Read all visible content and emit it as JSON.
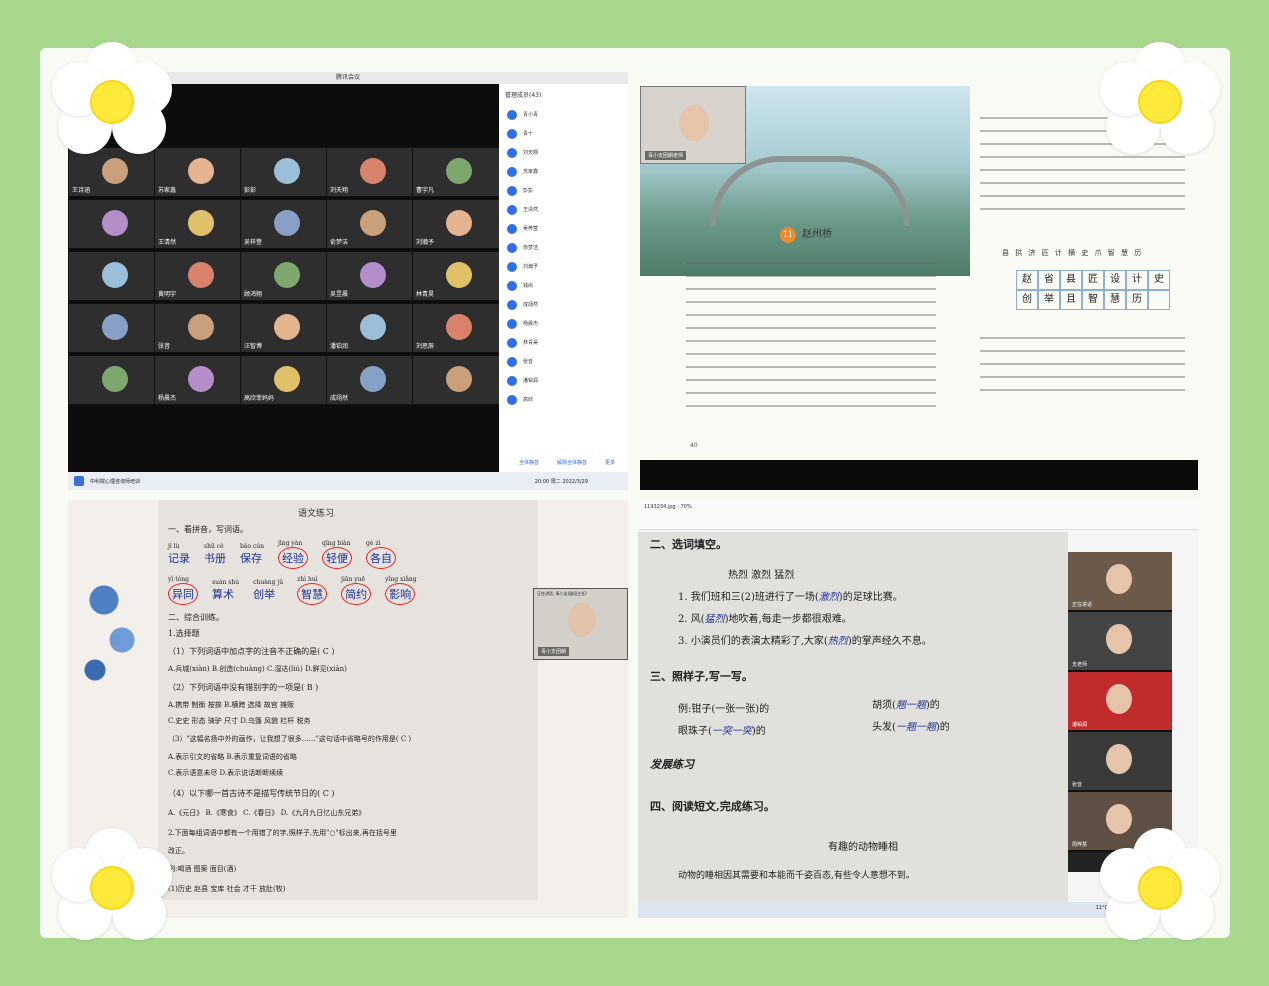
{
  "colors": {
    "background": "#a8d88e",
    "flower_center": "#ffe93a",
    "accent_blue": "#2f6ee8",
    "circle_red": "#e22222",
    "handwriting": "#1b2f9a"
  },
  "meeting": {
    "window_title": "腾讯会议",
    "sidebar_title": "管理成员(43)",
    "sidebar_names": [
      "青小青",
      "青十",
      "刘天翔",
      "苏家鑫",
      "彭彭",
      "王清然",
      "吴梓萱",
      "俞梦洁",
      "刘瀚予",
      "钱尚",
      "成翊然",
      "杨晨杰",
      "林青昊",
      "张音",
      "潘铂润",
      "高欣"
    ],
    "tiles": [
      {
        "name": "王诗涵"
      },
      {
        "name": "苏家鑫"
      },
      {
        "name": "彭彭"
      },
      {
        "name": "刘天翔"
      },
      {
        "name": "曹宇凡"
      },
      {
        "name": ""
      },
      {
        "name": "王清然"
      },
      {
        "name": "吴梓萱"
      },
      {
        "name": "俞梦洁"
      },
      {
        "name": "刘瀚予"
      },
      {
        "name": ""
      },
      {
        "name": "黄明宇"
      },
      {
        "name": "顾鸿翔"
      },
      {
        "name": "吴昱晨"
      },
      {
        "name": "林青昊"
      },
      {
        "name": ""
      },
      {
        "name": "张音"
      },
      {
        "name": "汪智博"
      },
      {
        "name": "潘铂润"
      },
      {
        "name": "刘思辰"
      },
      {
        "name": ""
      },
      {
        "name": "杨晨杰"
      },
      {
        "name": "高欣菲妈妈"
      },
      {
        "name": "成翊然"
      },
      {
        "name": ""
      }
    ],
    "buttons": [
      "全体静音",
      "解除全体静音",
      "更多"
    ],
    "taskbar_time": "20:00 周二 2022/3/29",
    "taskbar_app": "中科院心理咨询师培训"
  },
  "textbook": {
    "speaker_label": "正在讲话: 青小支(副班主任)",
    "webcam_name": "青小支团朗老师",
    "lesson_number": "11",
    "lesson_title": "赵州桥",
    "pinyin_row": "县 拱 济 匠 计 横 史 爪 智 慧 历",
    "vocab": [
      "赵",
      "省",
      "县",
      "匠",
      "设",
      "计",
      "史",
      "创",
      "举",
      "且",
      "智",
      "慧",
      "历",
      ""
    ],
    "page_number": "40"
  },
  "worksheet": {
    "title": "语文练习",
    "section1": "一、看拼音，写词语。",
    "pinyin_words": [
      {
        "py": "jì lù",
        "w": "记录",
        "circled": false
      },
      {
        "py": "shū cè",
        "w": "书册",
        "circled": false
      },
      {
        "py": "bǎo cún",
        "w": "保存",
        "circled": false
      },
      {
        "py": "jīng yàn",
        "w": "经验",
        "circled": true
      },
      {
        "py": "qīng biàn",
        "w": "轻便",
        "circled": true
      },
      {
        "py": "gè zì",
        "w": "各自",
        "circled": true
      }
    ],
    "pinyin_words2": [
      {
        "py": "yì tóng",
        "w": "异同",
        "circled": true
      },
      {
        "py": "suàn shù",
        "w": "算术",
        "circled": false
      },
      {
        "py": "chuàng jǔ",
        "w": "创举",
        "circled": false
      },
      {
        "py": "zhì huì",
        "w": "智慧",
        "circled": true
      },
      {
        "py": "jiān yuē",
        "w": "简约",
        "circled": true
      },
      {
        "py": "yǐng xiǎng",
        "w": "影响",
        "circled": true
      }
    ],
    "section2": "二、综合训练。",
    "q_choice": "1.选择题",
    "q1": "（1）下列词语中加点字的注音不正确的是( C )",
    "q1_opts": "A.兵城(xiàn)  B.创造(chuàng)  C.湿达(liú)  D.鲜见(xiān)",
    "q2": "（2）下列词语中没有错别字的一项是( B )",
    "q2_opts": "A.携带 制衡 按捺    B.横跨 选择 故宫 摊贩",
    "q2_opts2": "C.史史 形态 骑驴 尺寸    D.乌篷 风貌 栏杆 税务",
    "q3": "（3）\"这幅名扬中外的画作，让我想了很多……\"这句话中省略号的作用是( C )",
    "q3_opts": "A.表示引文的省略    B.表示重复词语的省略",
    "q3_opts2": "C.表示语意未尽    D.表示说话断断续续",
    "q4": "（4）以下哪一首古诗不是描写传统节日的( C )",
    "q4_opts": "A.《元日》  B.《寒食》  C.《春日》  D.《九月九日忆山东兄弟》",
    "q5": "2.下面每组词语中都有一个用错了的字,照样子,先用\"○\"标出来,再在括号里",
    "q5b": "改正。",
    "q5_ex": "例:喝酒 图案 面目(酒)",
    "q5_1": "(1)历史  赵县  宝库  社会  才干  放肚(牧)",
    "webcam_label": "正在讲话: 青小支(副班主任)",
    "webcam_name": "青小支团朗"
  },
  "fillblank": {
    "file_title": "1193234.jpg - 70%",
    "h1": "二、选词填空。",
    "choices": "热烈    激烈    猛烈",
    "s1": "1. 我们班和三(2)班进行了一场(",
    "s1_ans": "激烈",
    "s1_end": ")的足球比赛。",
    "s2": "2. 风(",
    "s2_ans": "猛烈",
    "s2_end": ")地吹着,每走一步都很艰难。",
    "s3": "3. 小演员们的表演太精彩了,大家(",
    "s3_ans": "热烈",
    "s3_end": ")的掌声经久不息。",
    "h2": "三、照样子,写一写。",
    "e1": "例:钳子(一张一张)的",
    "e2": "胡须(",
    "e2_ans": "翘一翘",
    "e2_end": ")的",
    "e3": "眼珠子(",
    "e3_ans": "一突一突",
    "e3_end": ")的",
    "e4": "头发(",
    "e4_ans": "一翘一翘",
    "e4_end": ")的",
    "h3": "发展练习",
    "h4": "四、阅读短文,完成练习。",
    "story_title": "有趣的动物睡相",
    "story_line": "动物的睡相因其需要和本能而千姿百态,有些令人意想不到。",
    "cams": [
      {
        "name": "正在讲话"
      },
      {
        "name": "支老师"
      },
      {
        "name": "潘铂润"
      },
      {
        "name": "张音"
      },
      {
        "name": "周梓慧"
      }
    ],
    "temp": "11°C"
  }
}
